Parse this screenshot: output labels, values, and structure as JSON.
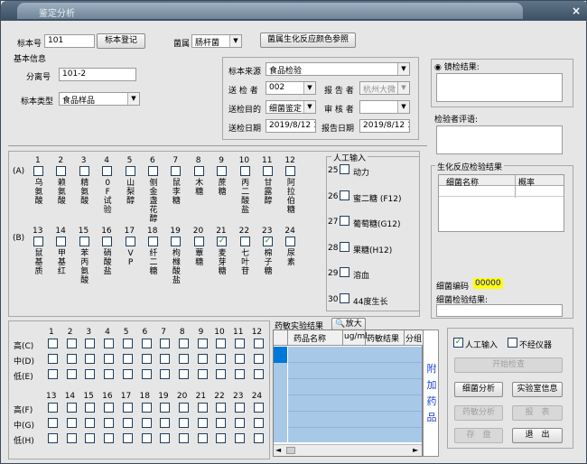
{
  "window": {
    "title": "鉴定分析",
    "close": "×"
  },
  "top": {
    "specimen_no_label": "标本号",
    "specimen_no": "101",
    "register_btn": "标本登记",
    "genus_label": "菌属",
    "genus": "肠杆菌",
    "color_ref_btn": "菌属生化反应颜色参照"
  },
  "basic": {
    "title": "基本信息",
    "isolate_label": "分离号",
    "isolate": "101-2",
    "type_label": "标本类型",
    "type": "食品样品"
  },
  "source": {
    "source_label": "标本来源",
    "source": "食品检验",
    "sender_label": "送 检 者",
    "sender": "002",
    "reporter_label": "报 告 者",
    "reporter": "杭州大微",
    "purpose_label": "送检目的",
    "purpose": "细菌鉴定",
    "reviewer_label": "审 核 者",
    "reviewer": "",
    "send_date_label": "送检日期",
    "send_date": "2019/8/12 1",
    "report_date_label": "报告日期",
    "report_date": "2019/8/12 1!"
  },
  "mirror": {
    "label": "镜检结果:",
    "comment_label": "检验者评语:"
  },
  "biochem": {
    "title": "生化反应检验结果",
    "col_name": "细菌名称",
    "col_prob": "概率",
    "code_label": "细菌编码",
    "code": "00000",
    "result_label": "细菌检验结果:"
  },
  "reactions": {
    "row_a_label": "(A)",
    "row_b_label": "(B)",
    "a": [
      {
        "n": "1",
        "t": "乌氨酸",
        "c": false
      },
      {
        "n": "2",
        "t": "赖氨酸",
        "c": false
      },
      {
        "n": "3",
        "t": "精氨酸",
        "c": false
      },
      {
        "n": "4",
        "t": "0F试验",
        "c": false
      },
      {
        "n": "5",
        "t": "山梨醇",
        "c": false
      },
      {
        "n": "6",
        "t": "侧金盏花醇",
        "c": false
      },
      {
        "n": "7",
        "t": "鼠李糖",
        "c": false
      },
      {
        "n": "8",
        "t": "木糖",
        "c": false
      },
      {
        "n": "9",
        "t": "蔗糖",
        "c": false
      },
      {
        "n": "10",
        "t": "丙二酸盐",
        "c": false
      },
      {
        "n": "11",
        "t": "甘露醇",
        "c": false
      },
      {
        "n": "12",
        "t": "阿拉伯糖",
        "c": false
      }
    ],
    "b": [
      {
        "n": "13",
        "t": "鼠基质",
        "c": false
      },
      {
        "n": "14",
        "t": "甲基红",
        "c": false
      },
      {
        "n": "15",
        "t": "苯丙氨酸",
        "c": false
      },
      {
        "n": "16",
        "t": "硝酸盐",
        "c": false
      },
      {
        "n": "17",
        "t": "VP",
        "c": false
      },
      {
        "n": "18",
        "t": "纤二糖",
        "c": false
      },
      {
        "n": "19",
        "t": "枸橼酸盐",
        "c": false
      },
      {
        "n": "20",
        "t": "蕈糖",
        "c": false
      },
      {
        "n": "21",
        "t": "麦芽糖",
        "c": true
      },
      {
        "n": "22",
        "t": "七叶苷",
        "c": false
      },
      {
        "n": "23",
        "t": "棉子糖",
        "c": true
      },
      {
        "n": "24",
        "t": "尿素",
        "c": false
      }
    ]
  },
  "manual": {
    "title": "人工输入",
    "items": [
      {
        "n": "25",
        "t": "动力"
      },
      {
        "n": "26",
        "t": "蜜二糖 (F12)"
      },
      {
        "n": "27",
        "t": "葡萄糖(G12)"
      },
      {
        "n": "28",
        "t": "果糖(H12)"
      },
      {
        "n": "29",
        "t": "溶血"
      },
      {
        "n": "30",
        "t": "44度生长"
      }
    ]
  },
  "grid": {
    "cols1": [
      "1",
      "2",
      "3",
      "4",
      "5",
      "6",
      "7",
      "8",
      "9",
      "10",
      "11",
      "12"
    ],
    "rows1": [
      "高(C)",
      "中(D)",
      "低(E)"
    ],
    "cols2": [
      "13",
      "14",
      "15",
      "16",
      "17",
      "18",
      "19",
      "20",
      "21",
      "22",
      "23",
      "24"
    ],
    "rows2": [
      "高(F)",
      "中(G)",
      "低(H)"
    ]
  },
  "drug": {
    "title": "药敏实验结果",
    "zoom": "放大",
    "col_name": "药品名称",
    "col_conc": "ug/ml",
    "col_result": "药敏结果",
    "col_group": "分组",
    "attach": "附加药品"
  },
  "actions": {
    "manual_cb": "人工输入",
    "no_instr_cb": "不经仪器",
    "start": "开始检查",
    "bact_analysis": "细菌分析",
    "lab_info": "实验室信息",
    "drug_analysis": "药敏分析",
    "report": "报　表",
    "save": "存　盘",
    "exit": "退　出"
  }
}
